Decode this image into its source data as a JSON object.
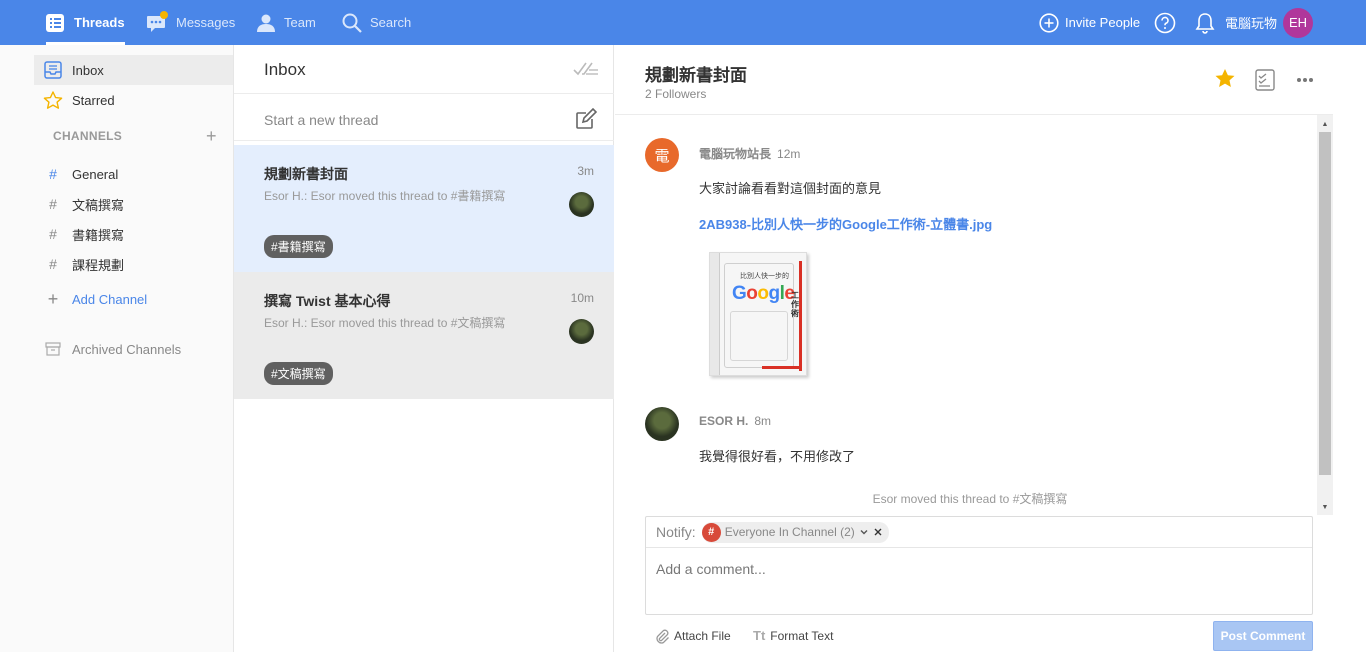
{
  "nav": {
    "threads": "Threads",
    "messages": "Messages",
    "team": "Team",
    "search": "Search",
    "invite": "Invite People",
    "workspace": "電腦玩物",
    "user_initials": "EH"
  },
  "sidebar": {
    "inbox": "Inbox",
    "starred": "Starred",
    "channels_heading": "CHANNELS",
    "channels": [
      {
        "label": "General"
      },
      {
        "label": "文稿撰寫"
      },
      {
        "label": "書籍撰寫"
      },
      {
        "label": "課程規劃"
      }
    ],
    "add_channel": "Add Channel",
    "archived": "Archived Channels"
  },
  "thread_list": {
    "title": "Inbox",
    "new_thread_placeholder": "Start a new thread",
    "threads": [
      {
        "title": "規劃新書封面",
        "time": "3m",
        "snippet": "Esor H.: Esor moved this thread to #書籍撰寫",
        "tag": "#書籍撰寫"
      },
      {
        "title": "撰寫 Twist 基本心得",
        "time": "10m",
        "snippet": "Esor H.: Esor moved this thread to #文稿撰寫",
        "tag": "#文稿撰寫"
      }
    ]
  },
  "detail": {
    "title": "規劃新書封面",
    "followers": "2 Followers",
    "messages": [
      {
        "author": "電腦玩物站長",
        "avatar_char": "電",
        "time": "12m",
        "body": "大家討論看看對這個封面的意見",
        "attachment": "2AB938-比別人快一步的Google工作術-立體書.jpg"
      },
      {
        "author": "ESOR H.",
        "time": "8m",
        "body": "我覺得很好看，不用修改了"
      }
    ],
    "system_note": "Esor moved this thread to #文稿撰寫",
    "book": {
      "google_word": "Google",
      "subtitle": "比別人快一步的",
      "side_word": "工作術"
    }
  },
  "composer": {
    "notify_label": "Notify:",
    "notify_chip": "Everyone In Channel (2)",
    "comment_placeholder": "Add a comment...",
    "attach_label": "Attach File",
    "format_label": "Format Text",
    "format_icon_text": "Tt",
    "post_label": "Post Comment"
  },
  "colors": {
    "accent": "#4a86e8",
    "star": "#f4b400",
    "avatar_eh": "#b0379b",
    "avatar_site": "#e8692b"
  }
}
